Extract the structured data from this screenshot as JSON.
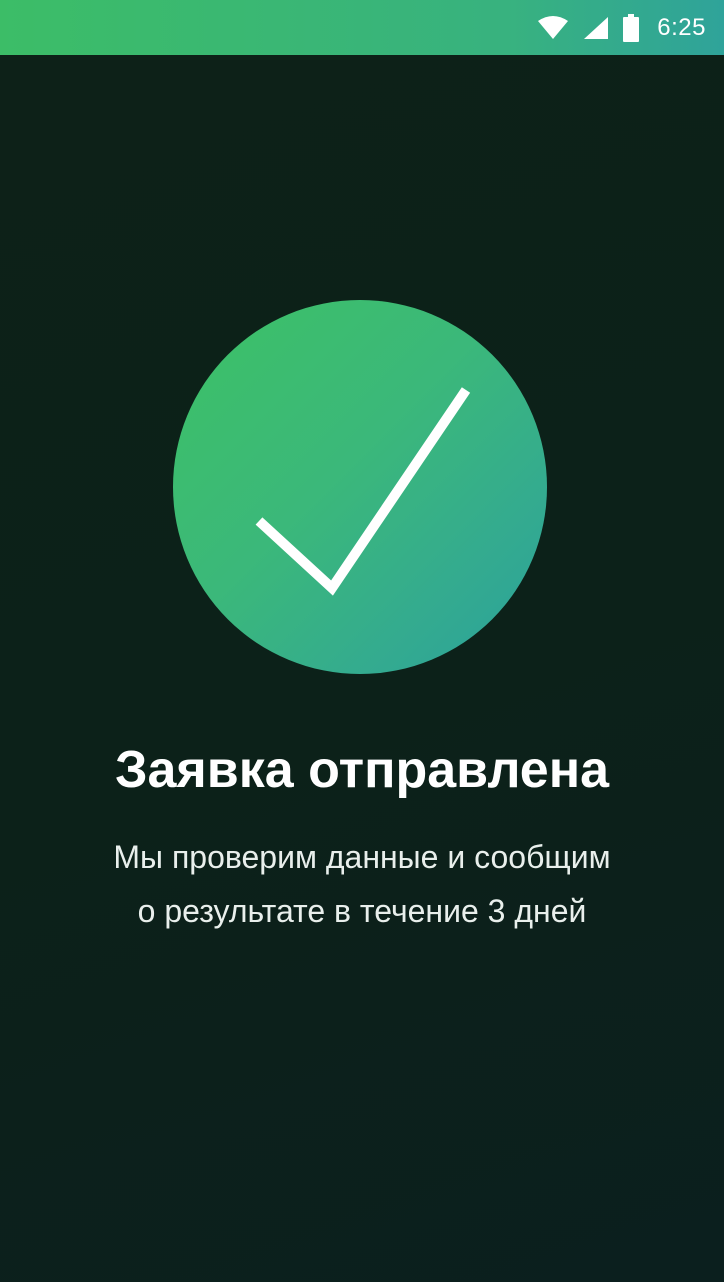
{
  "status_bar": {
    "time": "6:25",
    "icons": [
      "wifi-icon",
      "cellular-signal-icon",
      "battery-icon"
    ],
    "color": "#3cbd67"
  },
  "confirmation": {
    "icon": "checkmark-icon",
    "title": "Заявка отправлена",
    "message_lines": [
      "Мы проверим данные и сообщим",
      "о результате в течение 3 дней"
    ]
  },
  "colors": {
    "background": "#0d2118",
    "accent_start": "#3dc165",
    "accent_end": "#2aa19c",
    "text": "#ffffff"
  }
}
